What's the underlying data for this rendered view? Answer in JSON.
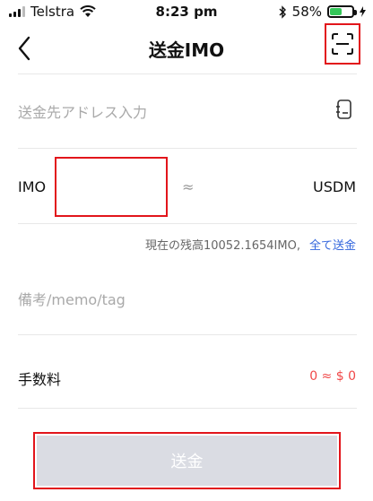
{
  "status_bar": {
    "carrier": "Telstra",
    "time": "8:23 pm",
    "battery_percent": "58%",
    "battery_level": 0.58
  },
  "nav": {
    "title": "送金IMO"
  },
  "address": {
    "placeholder": "送金先アドレス入力",
    "value": ""
  },
  "amount": {
    "coin": "IMO",
    "value": "",
    "approx_symbol": "≈",
    "fiat": "USDM"
  },
  "balance": {
    "text": "現在の残高10052.1654IMO,",
    "send_all_label": "全て送金"
  },
  "memo": {
    "placeholder": "備考/memo/tag",
    "value": ""
  },
  "fee": {
    "label": "手数料",
    "value": "0 ≈ $ 0"
  },
  "submit": {
    "label": "送金"
  },
  "colors": {
    "accent_link": "#3366dd",
    "fee_text": "#f04848",
    "highlight_border": "#e2151b",
    "disabled_button": "#dadce3"
  }
}
